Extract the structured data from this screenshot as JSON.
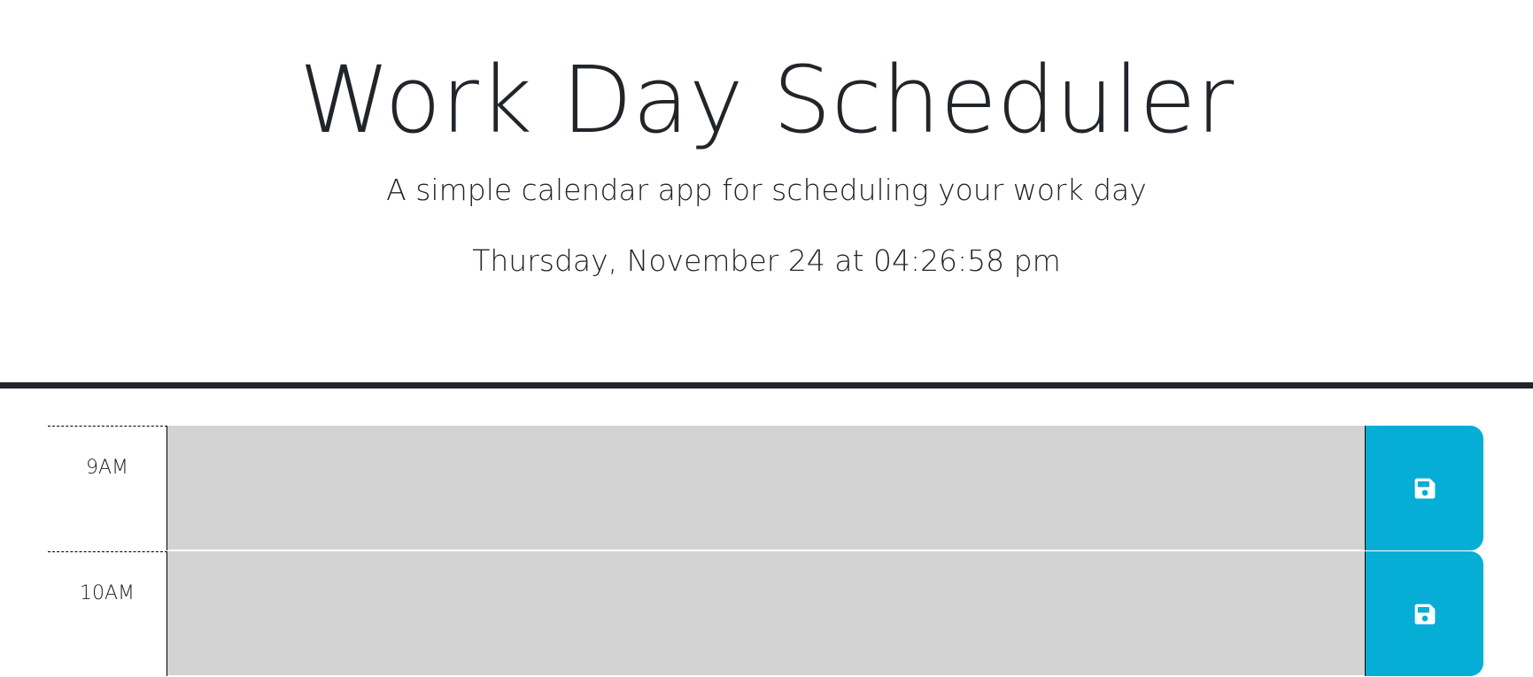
{
  "header": {
    "title": "Work Day Scheduler",
    "subtitle": "A simple calendar app for scheduling your work day",
    "current_day": "Thursday, November 24 at 04:26:58 pm"
  },
  "time_blocks": [
    {
      "hour": "9AM",
      "description": "",
      "state": "past",
      "save_icon": "floppy-disk-icon"
    },
    {
      "hour": "10AM",
      "description": "",
      "state": "past",
      "save_icon": "floppy-disk-icon"
    }
  ],
  "colors": {
    "past": "#d3d3d3",
    "save_button": "#06aed5",
    "divider": "#212529"
  }
}
